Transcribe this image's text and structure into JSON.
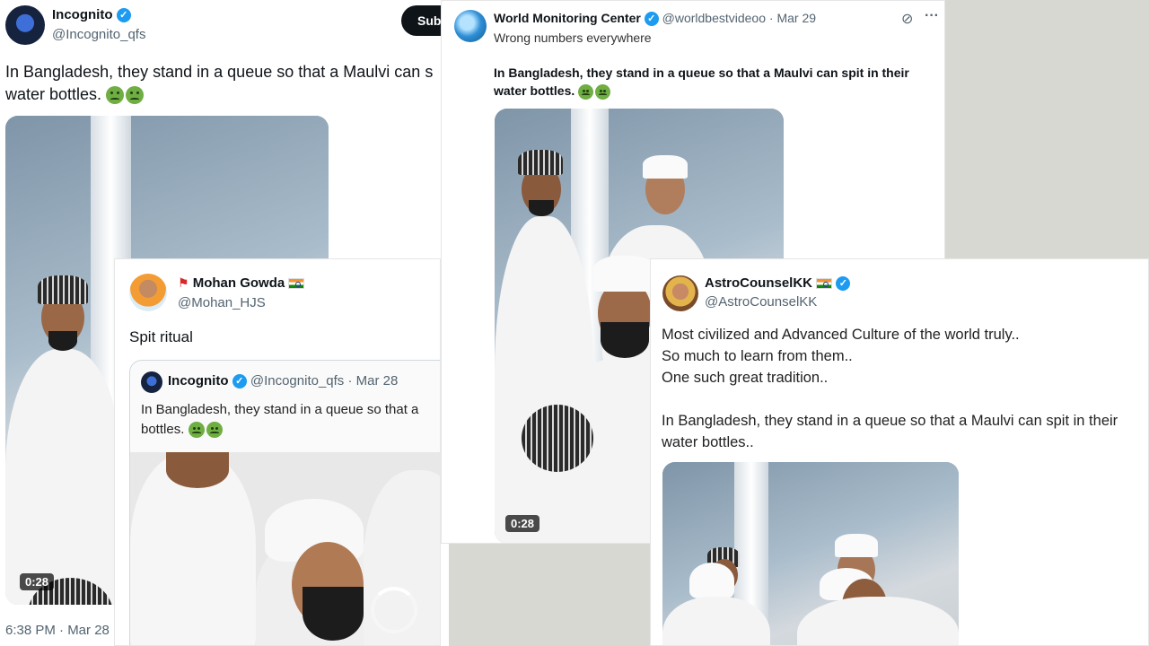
{
  "tweet_main": {
    "name": "Incognito",
    "handle": "@Incognito_qfs",
    "subscribe_label": "Sub",
    "text": "In Bangladesh, they stand in a queue so that a Maulvi can s",
    "text_line2": "water bottles.",
    "video_duration": "0:28",
    "timestamp": "6:38 PM · Mar 28"
  },
  "tweet_wmc": {
    "name": "World Monitoring Center",
    "handle": "@worldbestvideoo",
    "date": "· Mar 29",
    "comment": "Wrong numbers everywhere",
    "quote_text": "In Bangladesh, they stand in a queue so that a Maulvi can spit in their water bottles.",
    "video_duration": "0:28"
  },
  "tweet_mohan": {
    "name": "Mohan Gowda",
    "handle": "@Mohan_HJS",
    "text": "Spit ritual",
    "quoted": {
      "name": "Incognito",
      "handle": "@Incognito_qfs",
      "date": "· Mar 28",
      "text": "In Bangladesh, they stand in a queue so that a",
      "text_line2": "bottles."
    }
  },
  "tweet_astro": {
    "name": "AstroCounselKK",
    "handle": "@AstroCounselKK",
    "line1": "Most civilized and Advanced Culture of the world truly..",
    "line2": "So much to learn from them..",
    "line3": "One such great tradition..",
    "line4": "In Bangladesh, they stand in a queue so that a Maulvi can spit in their",
    "line5": "water bottles.."
  },
  "colors": {
    "verified": "#1d9bf0",
    "handle": "#536471"
  }
}
